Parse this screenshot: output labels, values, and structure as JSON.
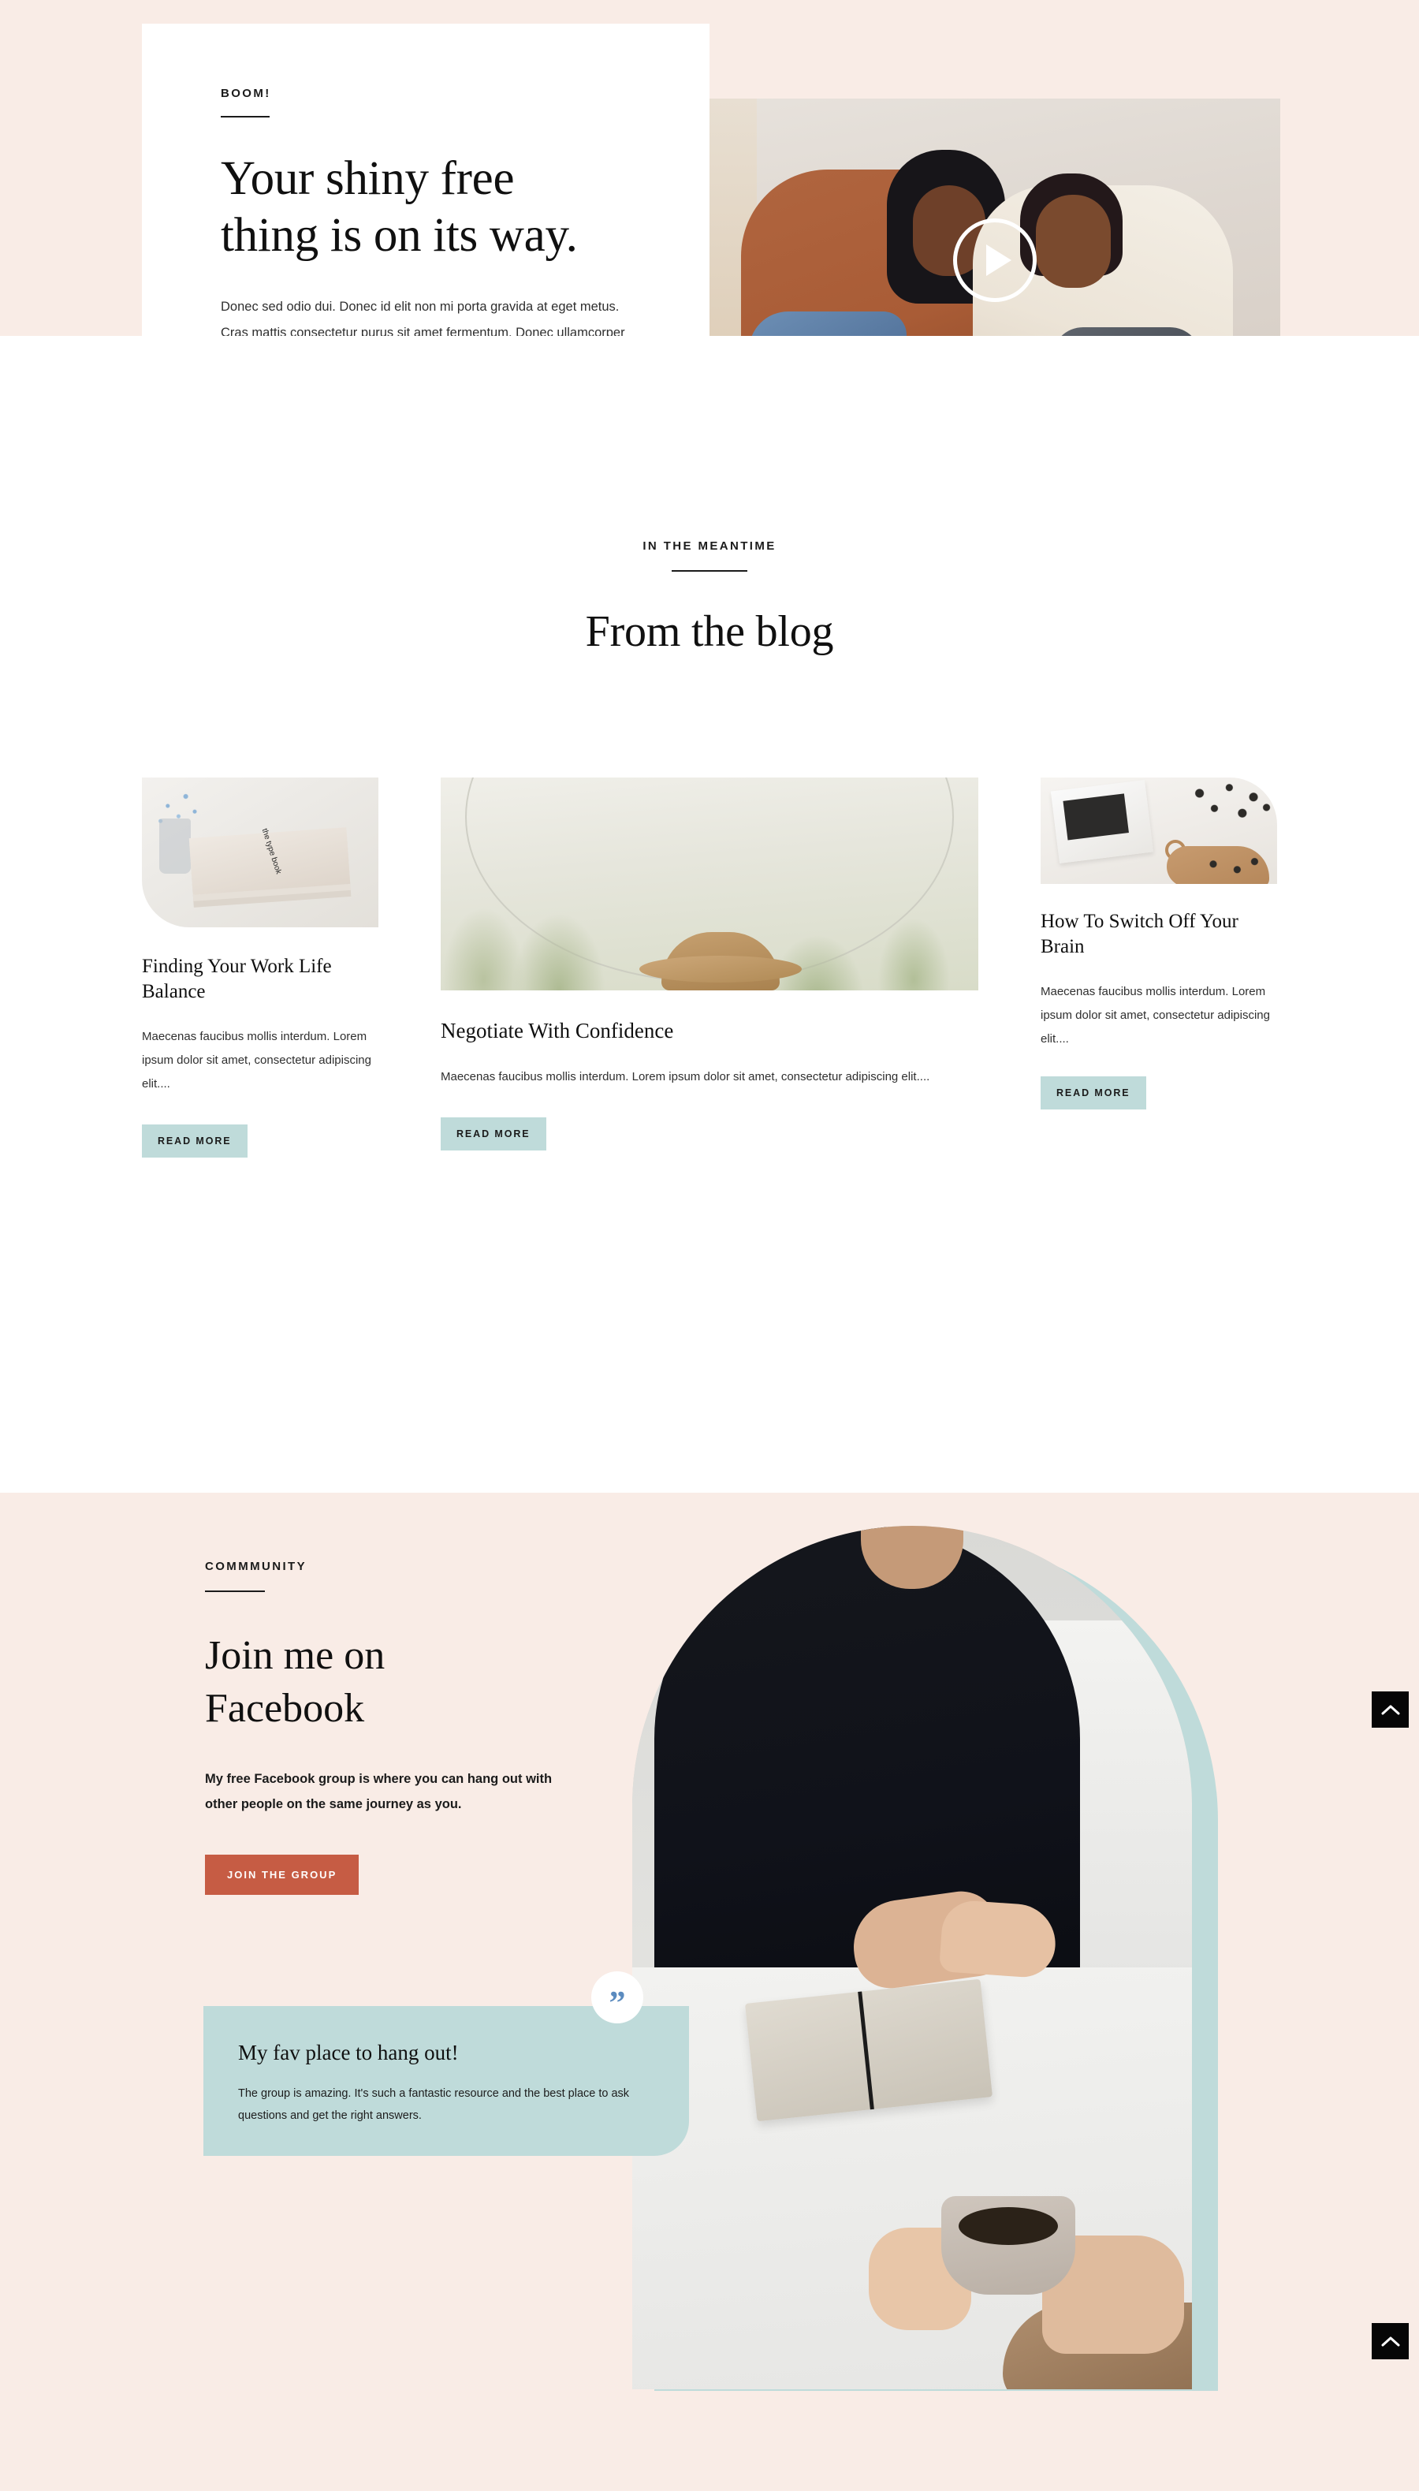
{
  "hero": {
    "eyebrow": "BOOM!",
    "title_line1": "Your shiny free",
    "title_line2": "thing is on its way.",
    "body": "Donec sed odio dui. Donec id elit non mi porta gravida at eget metus. Cras mattis consectetur purus sit amet fermentum. Donec ullamcorper nulla non metus auctor fringilla.",
    "video_icon": "play-icon",
    "bg_color": "#f9ece6",
    "card_color": "#ffffff"
  },
  "blog": {
    "eyebrow": "IN THE MEANTIME",
    "title": "From the blog",
    "read_more_color": "#bfdbda",
    "posts": [
      {
        "title": "Finding Your Work Life Balance",
        "excerpt": "Maecenas faucibus mollis interdum. Lorem ipsum dolor sit amet, consectetur adipiscing elit....",
        "cta": "READ MORE"
      },
      {
        "title": "Negotiate With Confidence",
        "excerpt": "Maecenas faucibus mollis interdum. Lorem ipsum dolor sit amet, consectetur adipiscing elit....",
        "cta": "READ MORE"
      },
      {
        "title": "How To Switch Off Your Brain",
        "excerpt": "Maecenas faucibus mollis interdum. Lorem ipsum dolor sit amet, consectetur adipiscing elit....",
        "cta": "READ MORE"
      }
    ]
  },
  "community": {
    "eyebrow": "COMMMUNITY",
    "title_line1": "Join me on",
    "title_line2": "Facebook",
    "body": "My free Facebook group is where you can hang out with other people on the same journey as you.",
    "cta": "JOIN THE GROUP",
    "cta_color": "#c65c44",
    "bg_color": "#f9ece6",
    "accent_color": "#bfdbda",
    "testimonial": {
      "quote_icon": "quote-icon",
      "heading": "My fav place to hang out!",
      "body": "The group is amazing. It's such a fantastic resource and the best place to ask questions and get the right answers."
    }
  },
  "scroll_top": {
    "icon": "chevron-up-icon",
    "label": "Scroll to top",
    "color": "#060606"
  }
}
